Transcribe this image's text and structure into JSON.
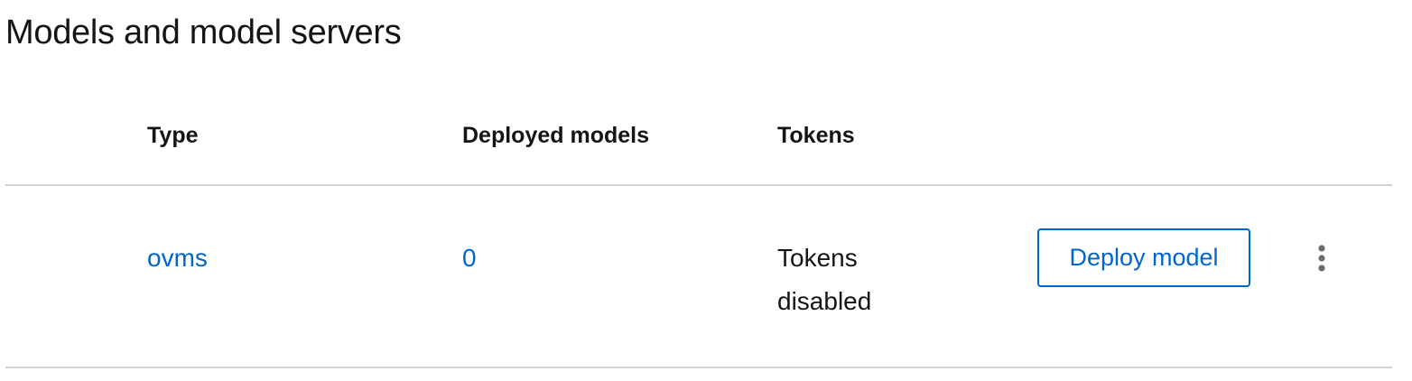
{
  "section": {
    "title": "Models and model servers"
  },
  "table": {
    "headers": {
      "type": "Type",
      "deployed_models": "Deployed models",
      "tokens": "Tokens"
    },
    "rows": [
      {
        "type": "ovms",
        "deployed_models": "0",
        "tokens_line1": "Tokens",
        "tokens_line2": "disabled",
        "action_label": "Deploy model",
        "menu_icon": "kebab-vertical-icon"
      }
    ]
  },
  "colors": {
    "link": "#0066cc",
    "text": "#151515",
    "border": "#d2d2d2",
    "kebab": "#6a6e73"
  }
}
